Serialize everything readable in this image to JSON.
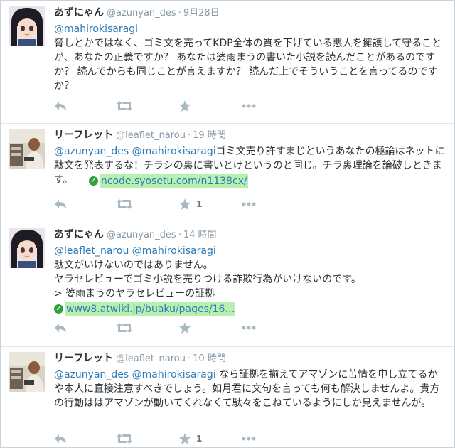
{
  "tweets": [
    {
      "name": "あずにゃん",
      "handle": "@azunyan_des",
      "dot": "·",
      "time": "9月28日",
      "reply_to": "@mahirokisaragi",
      "text": "脅しとかではなく、ゴミ文を売ってKDP全体の質を下げている悪人を擁護して守ることが、あなたの正義ですか？ あなたは婆雨まうの書いた小説を読んだことがあるのですか？ 読んでからも同じことが言えますか？ 読んだ上でそういうことを言ってるのですか？",
      "favorite_count": ""
    },
    {
      "name": "リーフレット",
      "handle": "@leaflet_narou",
      "dot": "·",
      "time": "19 時間",
      "mention1": "@azunyan_des",
      "mention2": "@mahirokisaragi",
      "text": "ゴミ文売り許すまじというあなたの極論はネットに駄文を発表するな！チラシの裏に書いとけというのと同じ。チラ裏理論を論破しときます。",
      "link": "ncode.syosetu.com/n1138cx/",
      "favorite_count": "1"
    },
    {
      "name": "あずにゃん",
      "handle": "@azunyan_des",
      "dot": "·",
      "time": "14 時間",
      "mention1": "@leaflet_narou",
      "mention2": "@mahirokisaragi",
      "line1": "駄文がいけないのではありません。",
      "line2": "ヤラセレビューでゴミ小説を売りつける詐欺行為がいけないのです。",
      "line3": "> 婆雨まうのヤラセレビューの証拠",
      "link": "www8.atwiki.jp/buaku/pages/16…",
      "favorite_count": ""
    },
    {
      "name": "リーフレット",
      "handle": "@leaflet_narou",
      "dot": "·",
      "time": "10 時間",
      "mention1": "@azunyan_des",
      "mention2": "@mahirokisaragi",
      "text": "なら証拠を揃えてアマゾンに苦情を申し立てるかや本人に直接注意すべきでしょう。如月君に文句を言っても何も解決しませんよ。貴方の行動ははアマゾンが動いてくれなくて駄々をこねているようにしか見えませんが。",
      "favorite_count": "1"
    }
  ],
  "colors": {
    "link": "#2b7bb9",
    "link_highlight": "#b8f0b0",
    "verified_check": "#2fa33a",
    "muted": "#8899a6",
    "icon": "#aab8c2"
  },
  "icons": [
    "reply-icon",
    "retweet-icon",
    "favorite-icon",
    "more-icon",
    "check-circle-icon"
  ]
}
